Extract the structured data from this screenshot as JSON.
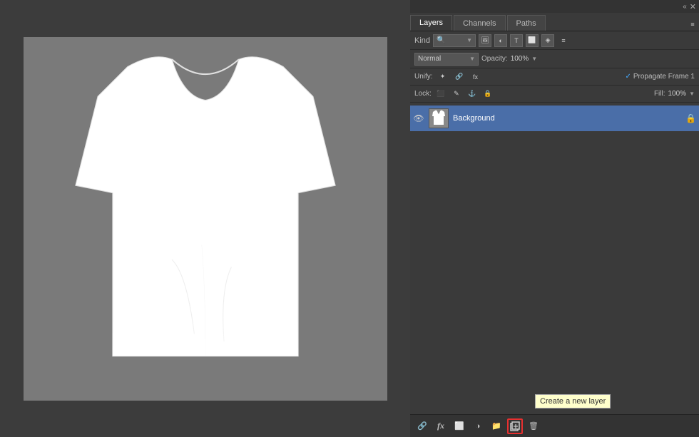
{
  "canvas": {
    "bg_color": "#3c3c3c"
  },
  "panels": {
    "top_bar": {
      "collapse_icon": "«",
      "close_icon": "✕"
    }
  },
  "tabs": {
    "layers_label": "Layers",
    "channels_label": "Channels",
    "paths_label": "Paths"
  },
  "toolbar": {
    "kind_label": "Kind",
    "blend_mode": "Normal",
    "blend_mode_chevron": "▼",
    "opacity_label": "Opacity:",
    "opacity_value": "100%",
    "opacity_chevron": "▼",
    "unify_label": "Unify:",
    "propagate_check": "✓",
    "propagate_label": "Propagate Frame 1",
    "lock_label": "Lock:",
    "fill_label": "Fill:",
    "fill_value": "100%",
    "fill_chevron": "▼"
  },
  "layer": {
    "name": "Background",
    "lock_icon": "🔒"
  },
  "bottom_bar": {
    "link_icon": "🔗",
    "fx_icon": "fx",
    "mask_icon": "⬜",
    "circle_icon": "◎",
    "folder_icon": "📁",
    "new_layer_icon": "📄",
    "delete_icon": "🗑",
    "new_layer_tooltip": "Create a new layer"
  }
}
